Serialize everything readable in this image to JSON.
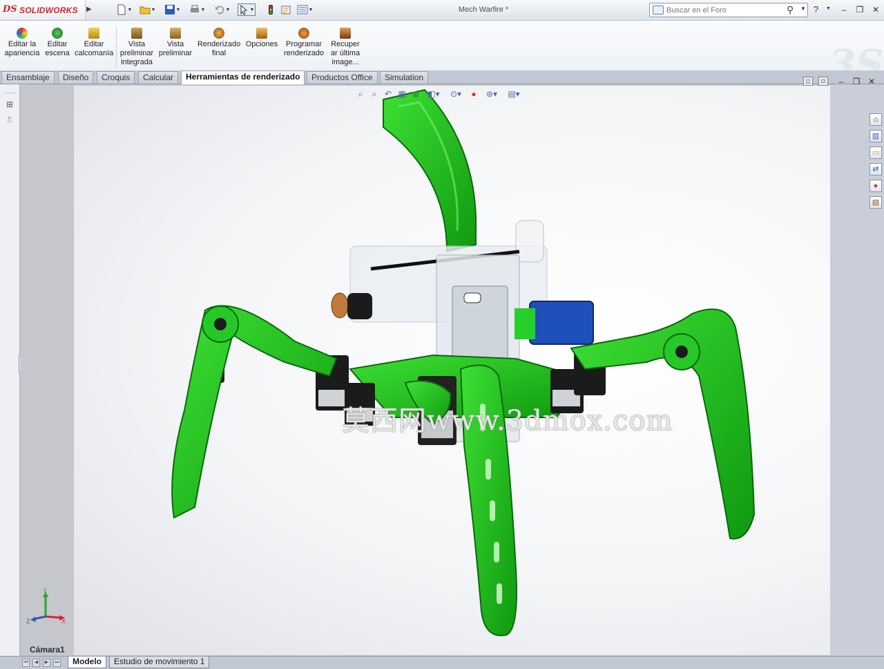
{
  "app": {
    "brand": "SOLIDWORKS",
    "brand_prefix": "DS",
    "document_title": "Mech Warfire *"
  },
  "search": {
    "placeholder": "Buscar en el Foro"
  },
  "ribbon": {
    "buttons": [
      {
        "label": "Editar la\napariencia",
        "icon": "appearance-icon"
      },
      {
        "label": "Editar\nescena",
        "icon": "scene-icon"
      },
      {
        "label": "Editar\ncalcomanía",
        "icon": "decal-icon"
      },
      {
        "label": "Vista\npreliminar\nintegrada",
        "icon": "integrated-preview-icon"
      },
      {
        "label": "Vista\npreliminar",
        "icon": "preview-window-icon"
      },
      {
        "label": "Renderizado\nfinal",
        "icon": "final-render-icon"
      },
      {
        "label": "Opciones",
        "icon": "options-icon"
      },
      {
        "label": "Programar\nrenderizado",
        "icon": "schedule-render-icon"
      },
      {
        "label": "Recuper\nar última\nimage...",
        "icon": "recover-image-icon"
      }
    ]
  },
  "tabs": [
    {
      "label": "Ensamblaje"
    },
    {
      "label": "Diseño"
    },
    {
      "label": "Croquis"
    },
    {
      "label": "Calcular"
    },
    {
      "label": "Herramientas de renderizado",
      "active": true
    },
    {
      "label": "Productos Office"
    },
    {
      "label": "Simulation"
    }
  ],
  "viewport": {
    "camera_label": "Cámara1",
    "watermark": "莫西网www.3dmox.com",
    "axis": {
      "x": "X",
      "y": "Y",
      "z": "Z"
    }
  },
  "bottom_tabs": [
    {
      "label": "Modelo",
      "active": true
    },
    {
      "label": "Estudio de movimiento 1"
    }
  ],
  "colors": {
    "accent_green": "#22c21c",
    "brand_red": "#d2232a",
    "motor_blue": "#1f4fb8"
  }
}
